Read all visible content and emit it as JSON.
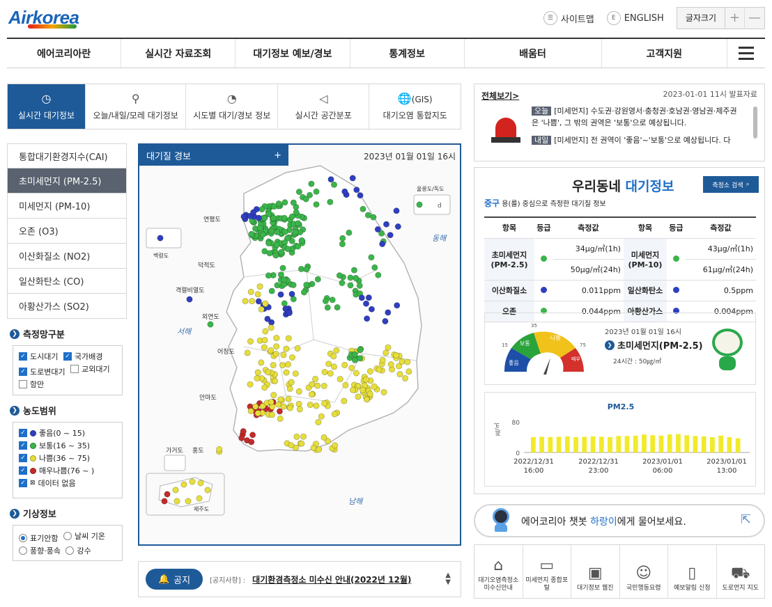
{
  "header": {
    "logo_air": "Air",
    "logo_korea": "korea",
    "sitemap": "사이트맵",
    "english": "ENGLISH",
    "english_badge": "E",
    "fontsize": "글자크기",
    "plus": "+",
    "minus": "—"
  },
  "gnb": [
    "에어코리아란",
    "실시간 자료조회",
    "대기정보 예보/경보",
    "통계정보",
    "배움터",
    "고객지원"
  ],
  "tabs": [
    {
      "label": "실시간 대기정보",
      "icon": "clock-icon"
    },
    {
      "label": "오늘/내일/모레 대기정보",
      "icon": "location-icon"
    },
    {
      "label": "시도별 대기/경보 정보",
      "icon": "gauge-icon"
    },
    {
      "label": "실시간 공간분포",
      "icon": "megaphone-icon"
    },
    {
      "label": "대기오염 통합지도",
      "icon": "globe-icon",
      "prefix": "(GIS)"
    }
  ],
  "left_menu": [
    "통합대기환경지수(CAI)",
    "초미세먼지 (PM-2.5)",
    "미세먼지 (PM-10)",
    "오존 (O3)",
    "이산화질소 (NO2)",
    "일산화탄소 (CO)",
    "아황산가스 (SO2)"
  ],
  "network": {
    "title": "측정망구분",
    "items": [
      {
        "label": "도시대기",
        "checked": true
      },
      {
        "label": "국가배경",
        "checked": true
      },
      {
        "label": "도로변대기",
        "checked": true
      },
      {
        "label": "교외대기",
        "checked": false
      },
      {
        "label": "항만",
        "checked": false
      }
    ]
  },
  "range": {
    "title": "농도범위",
    "items": [
      {
        "label": "좋음(0 ~ 15)",
        "color": "#2f3fbf"
      },
      {
        "label": "보통(16 ~ 35)",
        "color": "#3bb54a"
      },
      {
        "label": "나쁨(36 ~ 75)",
        "color": "#e6de3c"
      },
      {
        "label": "매우나쁨(76 ~ )",
        "color": "#c42b2b"
      },
      {
        "label": "데이터 없음",
        "color": "none"
      }
    ]
  },
  "weather": {
    "title": "기상정보",
    "items": [
      {
        "label": "표기안함",
        "checked": true
      },
      {
        "label": "날씨 기온",
        "checked": false
      },
      {
        "label": "풍향·풍속",
        "checked": false
      },
      {
        "label": "강수",
        "checked": false
      }
    ]
  },
  "map": {
    "title": "대기질 경보",
    "plus": "+",
    "time": "2023년 01월 01일 16시",
    "labels": {
      "ulleung": "울릉도/독도",
      "ulleung_d": "d",
      "baengnyeong": "백령도",
      "yeonpyeong": "연평도",
      "deokjeok": "덕적도",
      "gyeokryeol": "격렬비열도",
      "oeyeon": "외연도",
      "eocheong": "어청도",
      "anma": "안마도",
      "gageo": "가거도",
      "hong": "홍도",
      "jeju": "제주도",
      "west_sea": "서해",
      "east_sea": "동해",
      "south_sea": "남해"
    }
  },
  "notice": {
    "button": "공지",
    "category": "[공지사항] :",
    "text": "대기환경측정소 미수신 안내(2022년 12월)"
  },
  "news": {
    "all": "전체보기>",
    "issued": "2023-01-01 11시 발표자료",
    "today_tag": "오늘",
    "today_text": "[미세먼지] 수도권·강원영서·충청권·호남권·영남권·제주권은 '나쁨', 그 밖의 권역은 '보통'으로 예상됩니다.",
    "tomorrow_tag": "내일",
    "tomorrow_text": "[미세먼지] 전 권역이 '좋음'~'보통'으로 예상됩니다. 다"
  },
  "hood": {
    "title_a": "우리동네",
    "title_b": "대기정보",
    "search_btn": "측정소 검색",
    "district": "중구",
    "subtitle": "용(를) 중심으로 측정한 대기질 정보",
    "headers": [
      "항목",
      "등급",
      "측정값",
      "항목",
      "등급",
      "측정값"
    ],
    "rows": {
      "pm25_name": "초미세먼지 (PM-2.5)",
      "pm25_1h": "34μg/㎥(1h)",
      "pm25_24h": "50μg/㎥(24h)",
      "pm10_name": "미세먼지 (PM-10)",
      "pm10_1h": "43μg/㎥(1h)",
      "pm10_24h": "61μg/㎥(24h)",
      "no2_name": "이산화질소",
      "no2_val": "0.011ppm",
      "co_name": "일산화탄소",
      "co_val": "0.5ppm",
      "o3_name": "오존",
      "o3_val": "0.044ppm",
      "so2_name": "아황산가스",
      "so2_val": "0.004ppm"
    },
    "gauge": {
      "ticks": [
        "15",
        "35",
        "75"
      ],
      "segments": [
        "좋음",
        "보통",
        "나쁨",
        "매우 나쁨"
      ],
      "time": "2023년 01월 01일 16시",
      "pollutant": "초미세먼지(PM-2.5)",
      "value_24h": "24시간 : 50㎍/㎥"
    }
  },
  "chart_data": {
    "type": "bar",
    "title": "PM2.5",
    "ylabel": "㎍/㎥",
    "ylim": [
      0,
      80
    ],
    "yticks": [
      "0",
      "80"
    ],
    "x_labels": [
      [
        "2022/12/31",
        "16:00"
      ],
      [
        "2022/12/31",
        "23:00"
      ],
      [
        "2023/01/01",
        "06:00"
      ],
      [
        "2023/01/01",
        "13:00"
      ]
    ],
    "values": [
      40,
      41,
      40,
      41,
      42,
      40,
      41,
      42,
      41,
      40,
      43,
      43,
      44,
      47,
      45,
      44,
      47,
      48,
      45,
      43,
      42,
      40,
      44,
      40,
      37
    ]
  },
  "chatbot": {
    "text_a": "에어코리아 챗봇 ",
    "text_b": "하랑이",
    "text_c": "에게 물어보세요."
  },
  "quick_links": [
    {
      "label": "대기오염측정소 미수신안내",
      "icon": "house-signal-icon"
    },
    {
      "label": "미세먼지 종합포털",
      "icon": "monitor-search-icon"
    },
    {
      "label": "대기정보 웹진",
      "icon": "screen-icon"
    },
    {
      "label": "국민행동요령",
      "icon": "people-icon"
    },
    {
      "label": "예보알림 신청",
      "icon": "phone-mail-icon"
    },
    {
      "label": "도로먼지 지도",
      "icon": "car-icon"
    }
  ]
}
